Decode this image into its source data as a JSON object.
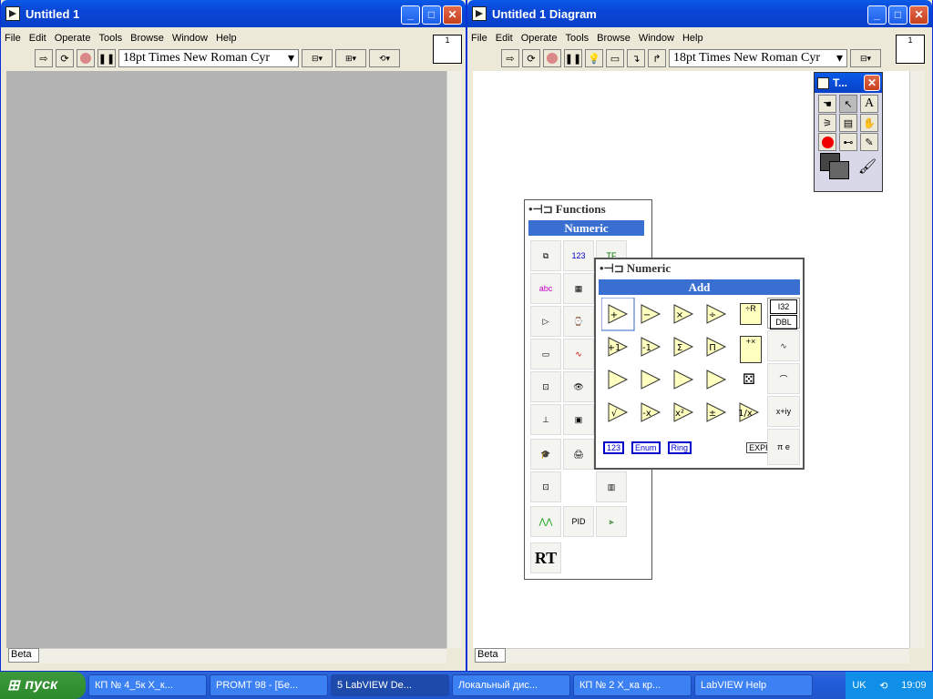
{
  "front_panel": {
    "title": "Untitled 1",
    "menu": [
      "File",
      "Edit",
      "Operate",
      "Tools",
      "Browse",
      "Window",
      "Help"
    ],
    "font": "18pt Times New Roman Cyr",
    "beta": "Beta",
    "conn_label": "1"
  },
  "diagram": {
    "title": "Untitled 1 Diagram",
    "menu": [
      "File",
      "Edit",
      "Operate",
      "Tools",
      "Browse",
      "Window",
      "Help"
    ],
    "font": "18pt Times New Roman Cyr",
    "beta": "Beta",
    "conn_label": "1"
  },
  "tools_palette": {
    "title": "T..."
  },
  "functions_palette": {
    "title": "Functions",
    "sub": "Numeric",
    "rt_label": "RT"
  },
  "numeric_palette": {
    "title": "Numeric",
    "sub": "Add",
    "consts": [
      "123",
      "Enum",
      "Ring",
      "EXPR"
    ],
    "side": [
      "I32",
      "DBL"
    ]
  },
  "taskbar": {
    "start": "пуск",
    "tasks": [
      "КП № 4_5к Х_к...",
      "PROMT 98 - [Бе...",
      "5 LabVIEW De...",
      "Локальный дис...",
      "КП № 2 Х_ка кр...",
      "LabVIEW Help"
    ],
    "lang": "UK",
    "clock": "19:09"
  }
}
